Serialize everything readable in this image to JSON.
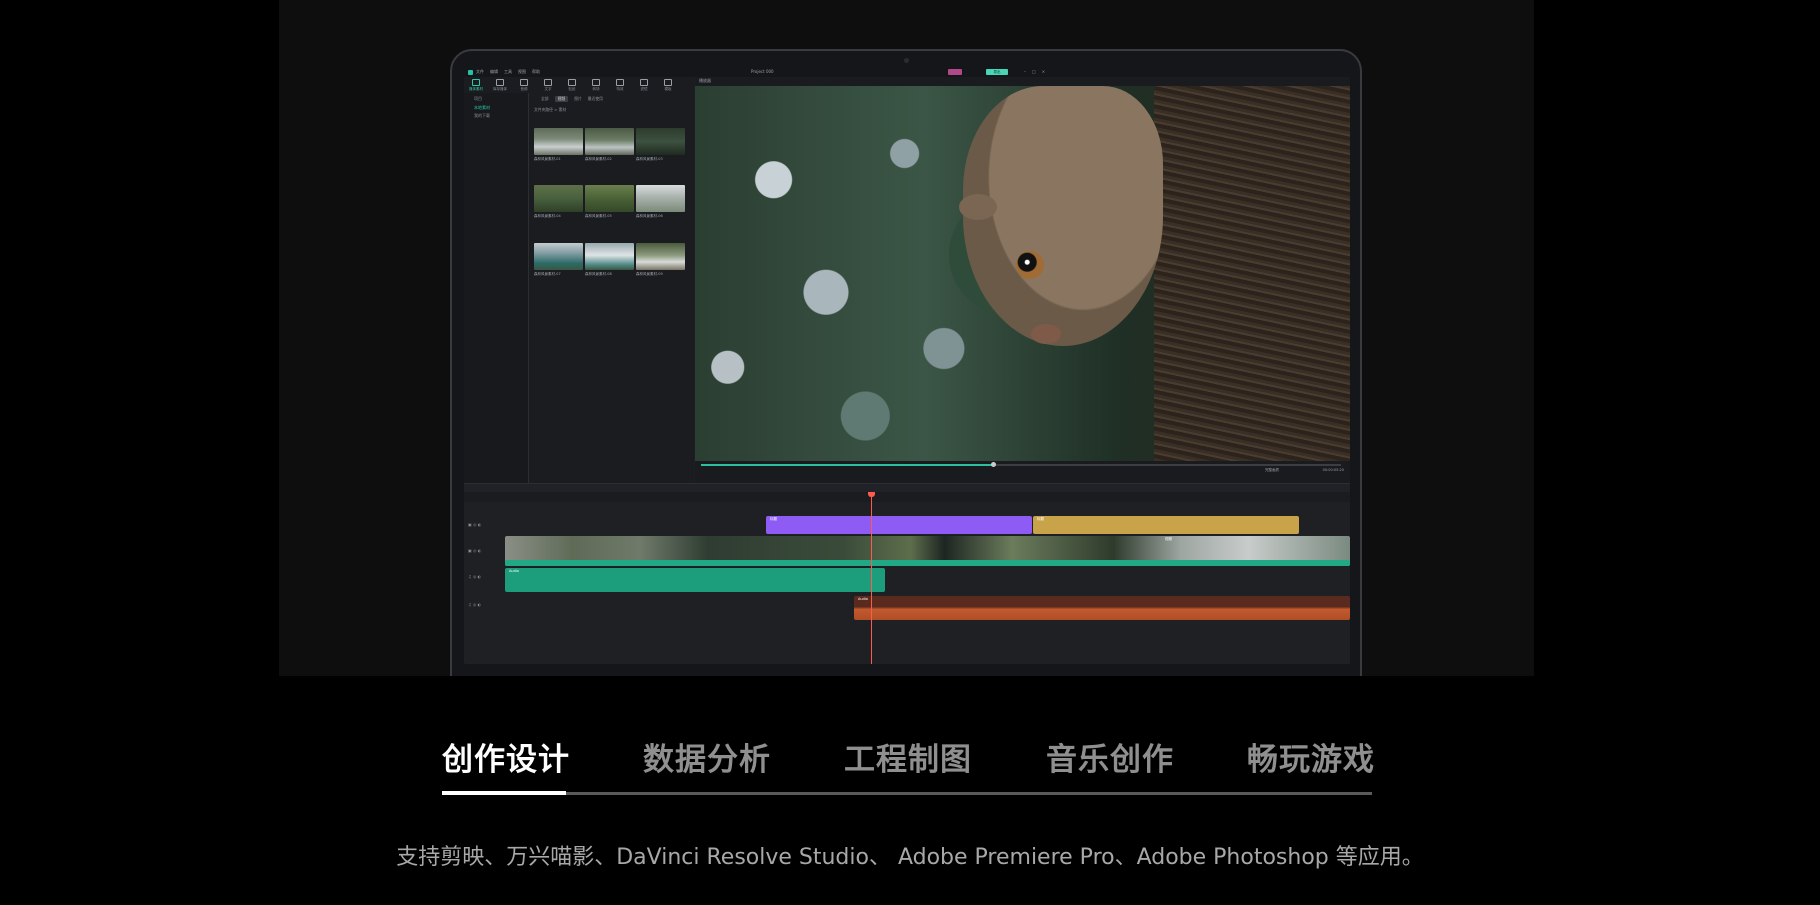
{
  "app": {
    "menu": [
      "文件",
      "编辑",
      "工具",
      "视图",
      "帮助"
    ],
    "project_title": "Project 000",
    "export_label": "导出",
    "toolbar": [
      "媒体素材",
      "库存媒体",
      "音频",
      "文字",
      "贴纸",
      "转场",
      "特效",
      "滤镜",
      "模板"
    ],
    "sidebar": [
      "项目",
      "本地素材",
      "我的下载"
    ],
    "media_tabs": [
      "全部",
      "视频",
      "图片",
      "最近使用"
    ],
    "breadcrumb": "文件夹路径 > 素材",
    "thumb_labels": [
      "森林风景素材-01",
      "森林风景素材-02",
      "森林风景素材-03",
      "森林风景素材-04",
      "森林风景素材-05",
      "森林风景素材-06",
      "森林风景素材-07",
      "森林风景素材-08",
      "森林风景素材-09"
    ],
    "preview_label": "播放器",
    "timecode": "00:00:05:20",
    "quality": "完整画质",
    "clips": {
      "title1": "标题",
      "title2": "标题",
      "video_label": "视频",
      "audio1": "Audio",
      "audio2": "Audio"
    },
    "colors": {
      "accent": "#2bbf9f",
      "title_clip": "#8e5cf5",
      "title_clip2": "#c9a34a",
      "video_bar": "#21a885",
      "audio1": "#1c9e7c",
      "audio2": "#c25a2e",
      "playhead": "#ff5a4e"
    }
  },
  "tabs": [
    "创作设计",
    "数据分析",
    "工程制图",
    "音乐创作",
    "畅玩游戏"
  ],
  "active_tab": 0,
  "caption": "支持剪映、万兴喵影、DaVinci Resolve Studio、 Adobe Premiere Pro、Adobe Photoshop 等应用。"
}
